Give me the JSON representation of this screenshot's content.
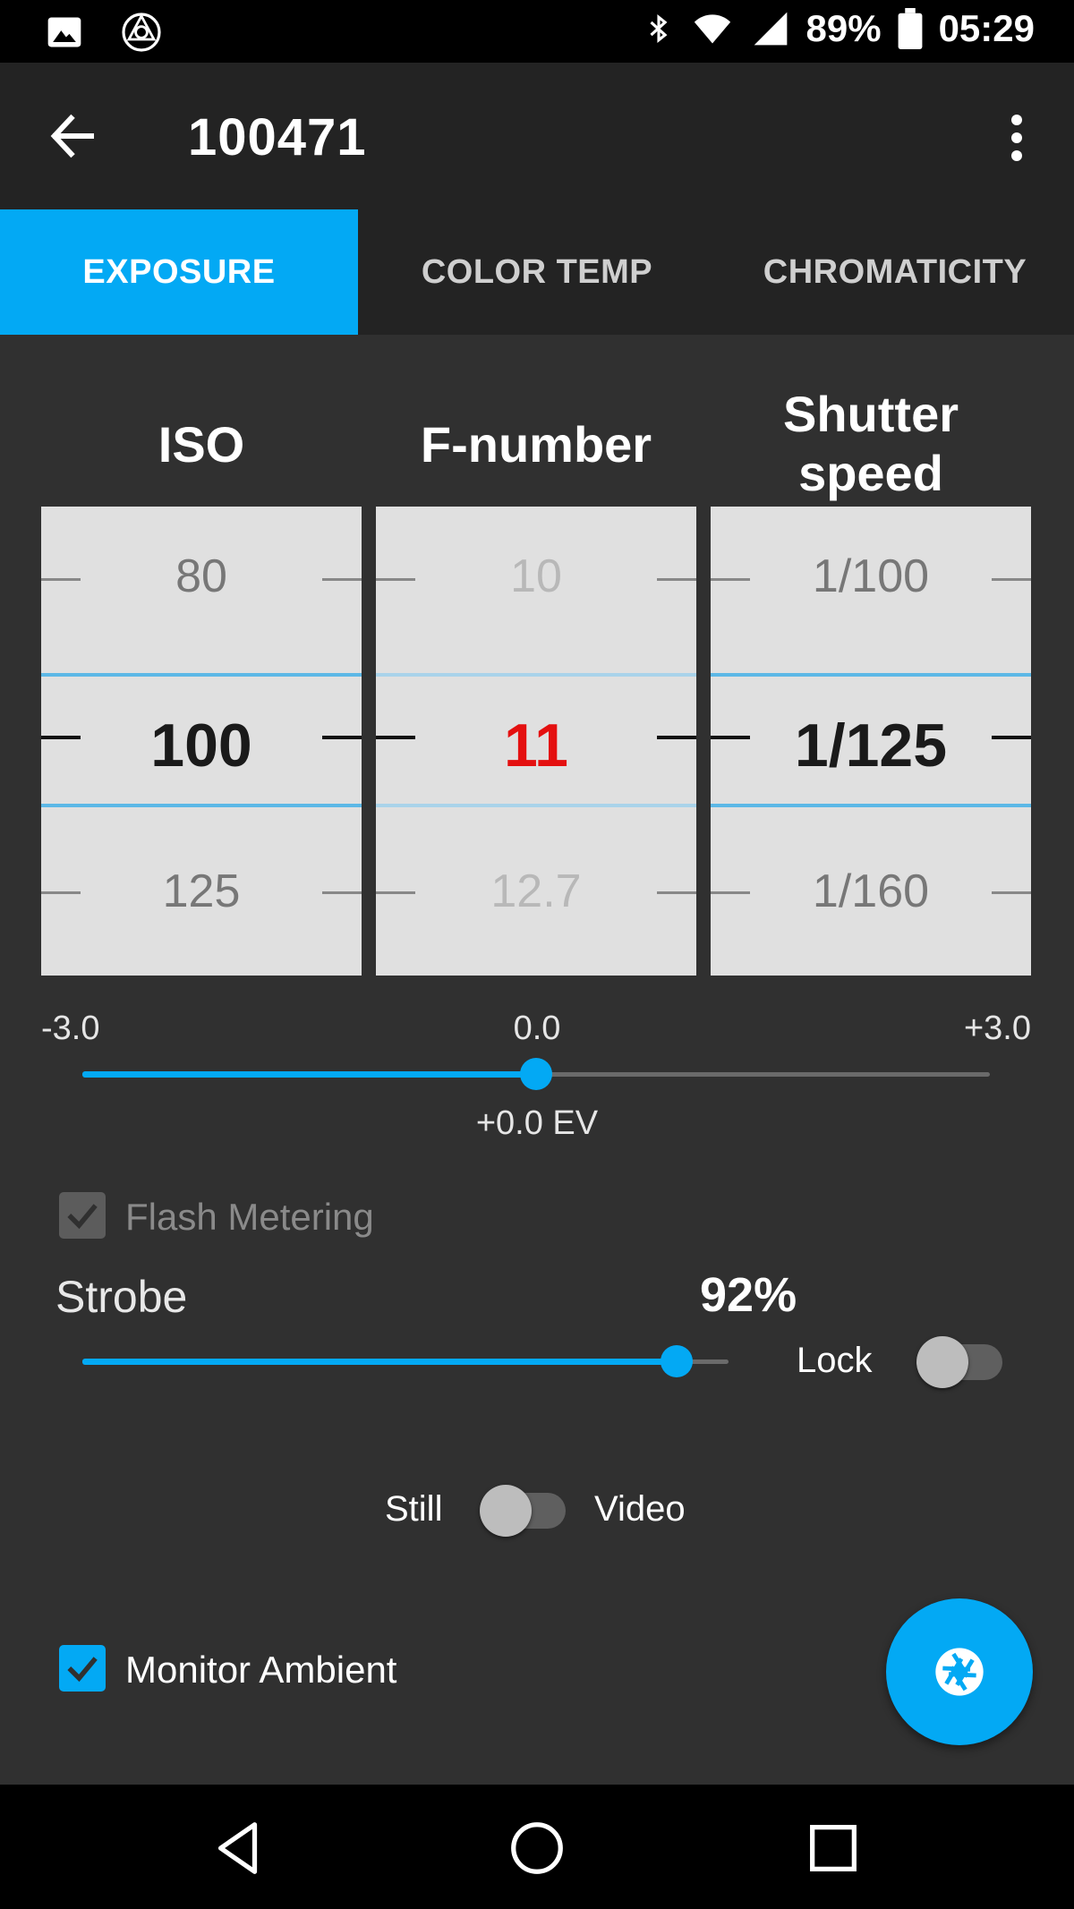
{
  "status_bar": {
    "icons_left": [
      "image-icon",
      "app-logo-icon"
    ],
    "icons_right": [
      "bluetooth-icon",
      "wifi-icon",
      "signal-icon",
      "battery-icon"
    ],
    "battery": "89%",
    "time": "05:29"
  },
  "app_bar": {
    "title": "100471",
    "back_icon": "arrow-back-icon",
    "menu_icon": "more-vert-icon"
  },
  "tabs": [
    {
      "label": "EXPOSURE",
      "active": true
    },
    {
      "label": "COLOR TEMP",
      "active": false
    },
    {
      "label": "CHROMATICITY",
      "active": false
    }
  ],
  "pickers": {
    "iso": {
      "title": "ISO",
      "prev": "80",
      "current": "100",
      "next": "125"
    },
    "fnumber": {
      "title": "F-number",
      "prev": "10",
      "current": "11",
      "next": "12.7"
    },
    "shutter": {
      "title_line1": "Shutter",
      "title_line2": "speed",
      "prev": "1/100",
      "current": "1/125",
      "next": "1/160"
    }
  },
  "ev_slider": {
    "min_label": "-3.0",
    "mid_label": "0.0",
    "max_label": "+3.0",
    "value_label": "+0.0 EV",
    "value": 0.0
  },
  "flash_metering": {
    "label": "Flash Metering",
    "checked": true,
    "enabled": false
  },
  "strobe": {
    "label": "Strobe",
    "percent_label": "92%",
    "value": 0.92,
    "lock_label": "Lock",
    "lock_on": false
  },
  "mode_toggle": {
    "left_label": "Still",
    "right_label": "Video",
    "on": false
  },
  "monitor_ambient": {
    "label": "Monitor Ambient",
    "checked": true
  },
  "fab_icon": "shutter-aperture-icon",
  "nav_bar": {
    "icons": [
      "nav-back-icon",
      "nav-home-icon",
      "nav-recents-icon"
    ]
  },
  "colors": {
    "accent": "#03a9f4",
    "highlight_red": "#e41010",
    "background": "#303030",
    "appbar": "#232323"
  }
}
